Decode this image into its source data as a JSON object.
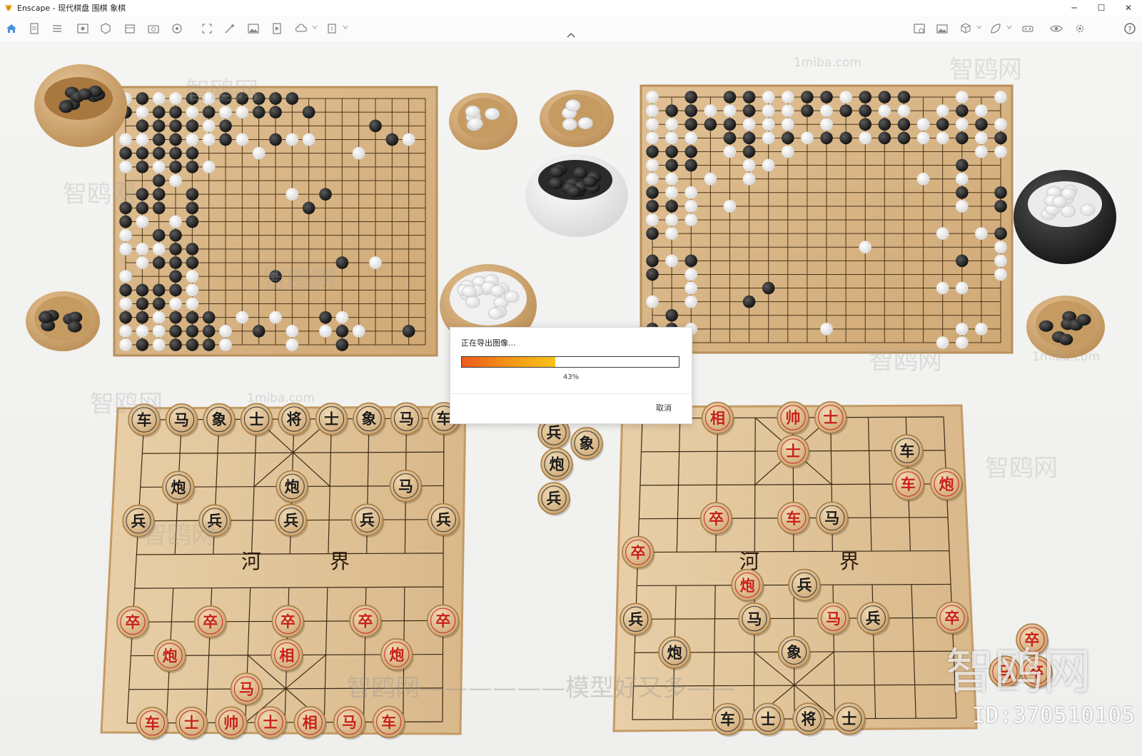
{
  "window": {
    "title": "Enscape - 现代棋盘 围棋 象棋",
    "controls": {
      "minimize": "─",
      "maximize": "☐",
      "close": "✕"
    }
  },
  "toolbar": {
    "left_icons": [
      "home-icon",
      "document-icon",
      "list-icon",
      "view-icon",
      "asset-library-icon",
      "building-icon",
      "capture-icon",
      "orbit-icon",
      "fit-view-icon",
      "wand-icon",
      "image-icon",
      "video-icon",
      "cloud-icon",
      "export-icon"
    ],
    "right_icons": [
      "image-settings-icon",
      "gallery-icon",
      "cube-icon",
      "leaf-icon",
      "vr-icon",
      "visibility-icon",
      "settings-icon",
      "help-icon"
    ]
  },
  "dialog": {
    "title": "正在导出图像...",
    "progress": 43,
    "progress_label": "43%",
    "cancel_label": "取消"
  },
  "watermarks": {
    "id_text": "ID:370510105",
    "brand": "智鸥网",
    "site": "1miba.com",
    "slogan": "智鸥网——————模型好又多——"
  },
  "river": {
    "left_a": "河",
    "left_b": "界",
    "right_a": "河",
    "right_b": "界"
  },
  "xiangqi_left": {
    "black_back": [
      "车",
      "马",
      "象",
      "士",
      "将",
      "士",
      "象",
      "马",
      "车"
    ],
    "black_cannons": [
      "炮",
      "炮",
      "马"
    ],
    "black_soldiers": [
      "兵",
      "兵",
      "兵",
      "兵",
      "兵"
    ],
    "red_soldiers": [
      "卒",
      "卒",
      "卒",
      "卒",
      "卒"
    ],
    "red_cannons": [
      "炮",
      "相",
      "炮"
    ],
    "red_horse": "马",
    "red_back": [
      "车",
      "士",
      "帅",
      "士",
      "相",
      "马",
      "车"
    ]
  },
  "xiangqi_right": {
    "red_top": [
      "相",
      "帅",
      "士"
    ],
    "red_mid": [
      "士",
      "车",
      "炮",
      "卒",
      "车"
    ],
    "black_mid": [
      "车",
      "马",
      "兵",
      "兵",
      "马",
      "兵",
      "炮",
      "象"
    ],
    "red_lower": [
      "卒",
      "炮",
      "马",
      "卒"
    ],
    "black_back": [
      "车",
      "士",
      "将",
      "士"
    ]
  },
  "side_pieces": [
    "兵",
    "象",
    "炮",
    "兵"
  ],
  "stray_pieces": [
    "卒",
    "马",
    "卒"
  ]
}
